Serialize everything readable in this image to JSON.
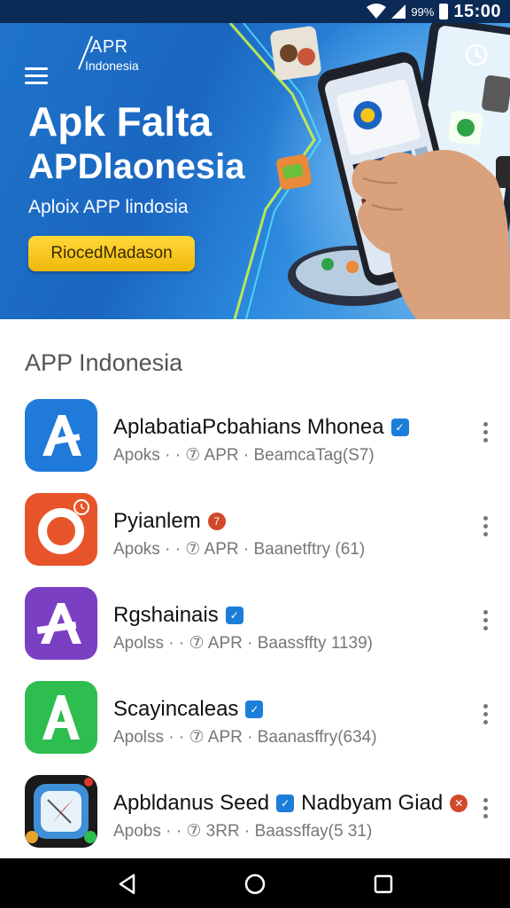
{
  "status_bar": {
    "battery": "99%",
    "time": "15:00"
  },
  "banner": {
    "logo_title": "APR",
    "logo_sub": "Indonesia",
    "title_line1": "Apk Falta",
    "title_line2": "APDlaonesia",
    "subtitle": "Aploix APP lindosia",
    "cta_label": "RiocedMadason"
  },
  "section_title": "APP Indonesia",
  "apps": [
    {
      "name": "AplabatiaPcbahians Mhonea",
      "meta": "Apoks · · ⑦ APR · BeamcaTag(S7)",
      "icon": "a-blue-icon",
      "badges": [
        "square"
      ]
    },
    {
      "name": "Pyianlem",
      "meta": "Apoks · · ⑦ APR · Baanetftry (61)",
      "icon": "ring-orange-icon",
      "badges": [
        "round"
      ]
    },
    {
      "name": "Rgshainais",
      "meta": "Apolss · · ⑦ APR · Baassffty 1139)",
      "icon": "a-purple-icon",
      "badges": [
        "square"
      ]
    },
    {
      "name": "Scayincaleas",
      "meta": "Apolss · · ⑦ APR · Baanasffry(634)",
      "icon": "a-green-icon",
      "badges": [
        "square"
      ]
    },
    {
      "name": "Apbldanus Seed",
      "name2": "Nadbyam Giad",
      "meta": "Apobs · · ⑦ 3RR · Baassffay(5 31)",
      "icon": "compass-icon",
      "badges": [
        "square",
        "round"
      ]
    }
  ],
  "colors": {
    "banner_blue": "#1f73c9",
    "cta_yellow": "#f5c518",
    "badge_blue": "#1b7fd9",
    "badge_red": "#d2482b"
  }
}
